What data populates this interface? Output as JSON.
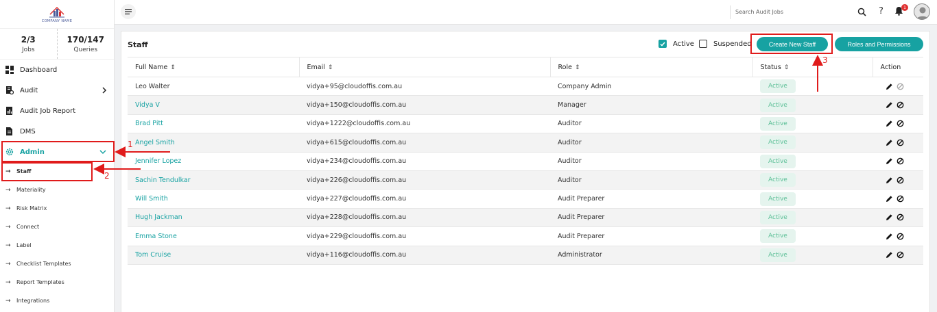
{
  "logo": {
    "text": "COMPANY NAME"
  },
  "stats": [
    {
      "value": "2/3",
      "label": "Jobs"
    },
    {
      "value": "170/147",
      "label": "Queries"
    }
  ],
  "nav": {
    "dashboard": "Dashboard",
    "audit": "Audit",
    "audit_job_report": "Audit Job Report",
    "dms": "DMS",
    "admin": "Admin"
  },
  "subnav": {
    "staff": "Staff",
    "materiality": "Materiality",
    "risk_matrix": "Risk Matrix",
    "connect": "Connect",
    "label": "Label",
    "checklist_templates": "Checklist Templates",
    "report_templates": "Report Templates",
    "integrations": "Integrations"
  },
  "topbar": {
    "search_placeholder": "Search Audit Jobs",
    "help": "?",
    "notification_count": "1"
  },
  "page": {
    "title": "Staff",
    "filter_active": "Active",
    "filter_suspended": "Suspended",
    "create_button": "Create New Staff",
    "roles_button": "Roles and Permissions"
  },
  "table": {
    "headers": {
      "full_name": "Full Name",
      "email": "Email",
      "role": "Role",
      "status": "Status",
      "action": "Action"
    },
    "rows": [
      {
        "name": "Leo Walter",
        "email": "vidya+95@cloudoffis.com.au",
        "role": "Company Admin",
        "status": "Active"
      },
      {
        "name": "Vidya V",
        "email": "vidya+150@cloudoffis.com.au",
        "role": "Manager",
        "status": "Active"
      },
      {
        "name": "Brad Pitt",
        "email": "vidya+1222@cloudoffis.com.au",
        "role": "Auditor",
        "status": "Active"
      },
      {
        "name": "Angel Smith",
        "email": "vidya+615@cloudoffis.com.au",
        "role": "Auditor",
        "status": "Active"
      },
      {
        "name": "Jennifer Lopez",
        "email": "vidya+234@cloudoffis.com.au",
        "role": "Auditor",
        "status": "Active"
      },
      {
        "name": "Sachin Tendulkar",
        "email": "vidya+226@cloudoffis.com.au",
        "role": "Auditor",
        "status": "Active"
      },
      {
        "name": "Will Smith",
        "email": "vidya+227@cloudoffis.com.au",
        "role": "Audit Preparer",
        "status": "Active"
      },
      {
        "name": "Hugh Jackman",
        "email": "vidya+228@cloudoffis.com.au",
        "role": "Audit Preparer",
        "status": "Active"
      },
      {
        "name": "Emma Stone",
        "email": "vidya+229@cloudoffis.com.au",
        "role": "Audit Preparer",
        "status": "Active"
      },
      {
        "name": "Tom Cruise",
        "email": "vidya+116@cloudoffis.com.au",
        "role": "Administrator",
        "status": "Active"
      }
    ]
  },
  "annotations": [
    "1",
    "2",
    "3"
  ],
  "colors": {
    "accent": "#17a2a2",
    "annotation": "#e01b1b",
    "status_bg": "#e5f4ee",
    "status_text": "#5bbf96"
  }
}
